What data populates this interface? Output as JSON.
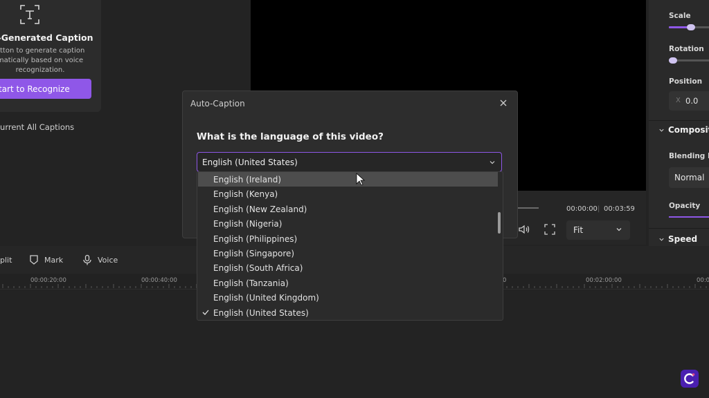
{
  "caption_panel": {
    "title": "o-Generated Caption",
    "description": "utton to generate caption\nmatically based on voice\nrecognization.",
    "start_button": "tart to Recognize",
    "clear_all": "Current All Captions"
  },
  "player": {
    "current_time": "00:00:00",
    "separator": "|",
    "total_time": "00:03:59",
    "fit_label": "Fit"
  },
  "properties": {
    "scale_label": "Scale",
    "scale_value": 0.55,
    "rotation_label": "Rotation",
    "rotation_value": 0.0,
    "position_label": "Position",
    "position_x_label": "X",
    "position_x_value": "0.0",
    "composition_label": "Compositi",
    "blending_label": "Blending M",
    "blending_value": "Normal",
    "opacity_label": "Opacity",
    "speed_label": "Speed"
  },
  "timeline": {
    "split_label": "plit",
    "mark_label": "Mark",
    "voice_label": "Voice",
    "ticks": [
      "00:00:20:00",
      "00:00:40:00",
      "0",
      "00:02:00:00",
      "00:02"
    ]
  },
  "dialog": {
    "title": "Auto-Caption",
    "question": "What is the language of this video?",
    "selected_language": "English (United States)",
    "options": [
      {
        "label": "English (Ireland)",
        "hover": true,
        "selected": false
      },
      {
        "label": "English (Kenya)",
        "hover": false,
        "selected": false
      },
      {
        "label": "English (New Zealand)",
        "hover": false,
        "selected": false
      },
      {
        "label": "English (Nigeria)",
        "hover": false,
        "selected": false
      },
      {
        "label": "English (Philippines)",
        "hover": false,
        "selected": false
      },
      {
        "label": "English (Singapore)",
        "hover": false,
        "selected": false
      },
      {
        "label": "English (South Africa)",
        "hover": false,
        "selected": false
      },
      {
        "label": "English (Tanzania)",
        "hover": false,
        "selected": false
      },
      {
        "label": "English (United Kingdom)",
        "hover": false,
        "selected": false
      },
      {
        "label": "English (United States)",
        "hover": false,
        "selected": true
      }
    ]
  },
  "colors": {
    "accent": "#8f57e8",
    "panel": "#2d2d2d",
    "background": "#232323"
  }
}
